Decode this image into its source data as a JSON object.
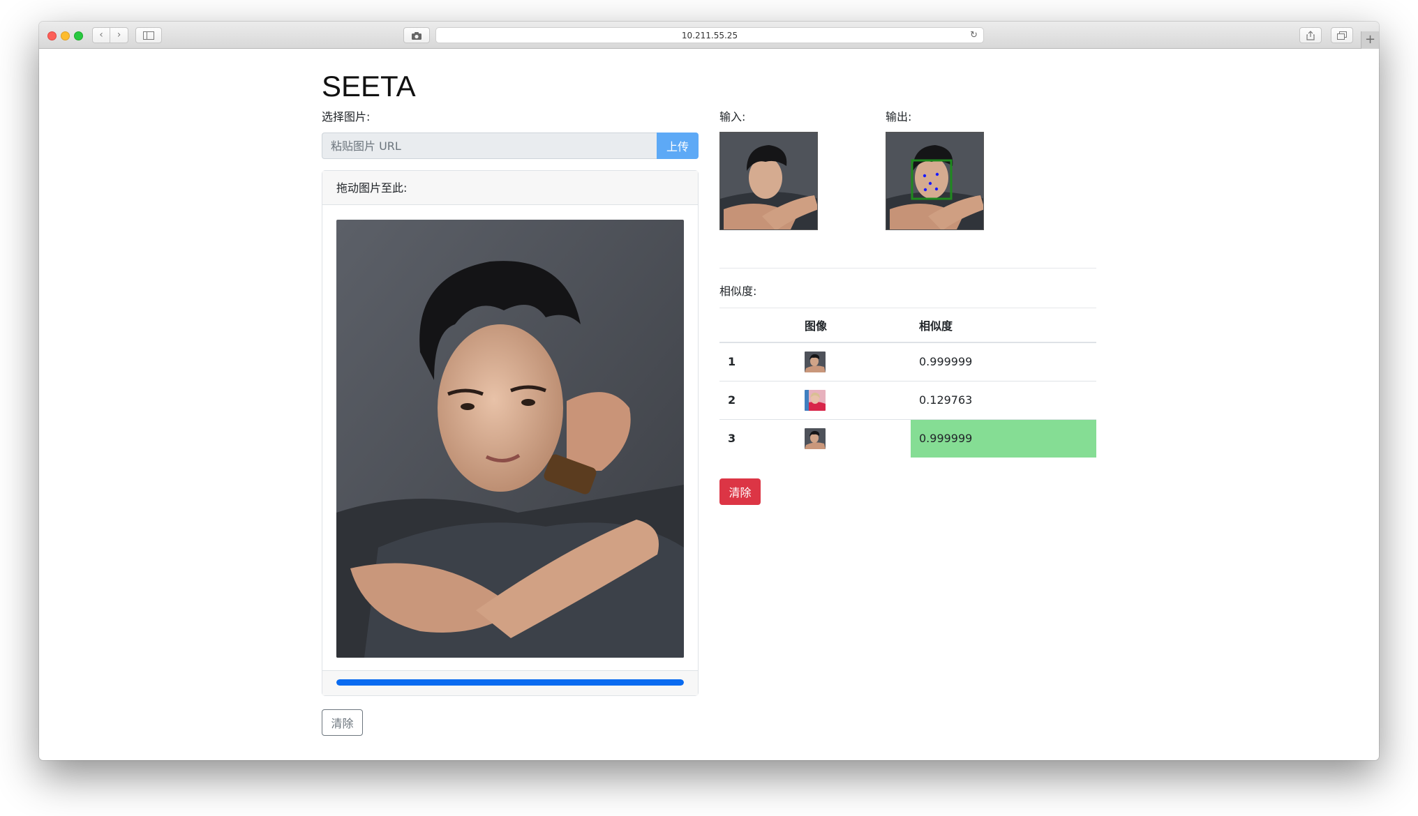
{
  "browser": {
    "url": "10.211.55.25",
    "nav_back_icon": "chevron-left-icon",
    "nav_forward_icon": "chevron-right-icon",
    "reload_icon": "reload-icon",
    "new_tab_symbol": "+"
  },
  "page": {
    "title": "SEETA",
    "select_label": "选择图片:",
    "url_placeholder": "粘贴图片 URL",
    "upload_button": "上传",
    "drop_header": "拖动图片至此:",
    "progress_percent": 100,
    "clear_button_left": "清除",
    "input_label": "输入:",
    "output_label": "输出:",
    "similarity_label": "相似度:",
    "clear_button_right": "清除"
  },
  "table": {
    "headers": [
      "",
      "图像",
      "相似度"
    ],
    "rows": [
      {
        "index": "1",
        "image": "portrait-thumbnail",
        "score": "0.999999",
        "highlight": false
      },
      {
        "index": "2",
        "image": "portrait-thumbnail-red",
        "score": "0.129763",
        "highlight": false
      },
      {
        "index": "3",
        "image": "portrait-thumbnail",
        "score": "0.999999",
        "highlight": true
      }
    ]
  },
  "colors": {
    "upload_button": "#5da9f6",
    "progress": "#0a6bf0",
    "danger": "#dc3545",
    "highlight": "#85dd94",
    "face_box": "#1f8a1f",
    "landmarks": "#1a1aff"
  }
}
